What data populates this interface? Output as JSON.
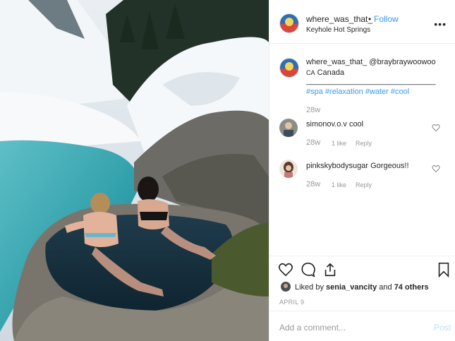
{
  "post": {
    "username": "where_was_that_",
    "follow_label": "Follow",
    "location": "Keyhole Hot Springs",
    "caption": {
      "username": "where_was_that_",
      "mention": "@braybraywoowoo",
      "country_code": "CA",
      "country": "Canada",
      "divider": "______________________________",
      "hashtags": [
        "#spa",
        "#relaxation",
        "#water",
        "#cool"
      ],
      "age": "28w"
    },
    "comments": [
      {
        "username": "simonov.o.v",
        "text": "cool",
        "age": "28w",
        "likes": "1 like",
        "reply": "Reply"
      },
      {
        "username": "pinkskybodysugar",
        "text": "Gorgeous!!",
        "age": "28w",
        "likes": "1 like",
        "reply": "Reply"
      }
    ],
    "likes": {
      "prefix": "Liked by",
      "user": "senia_vancity",
      "and": "and",
      "count_text": "74 others"
    },
    "date": "APRIL 9",
    "add_comment_placeholder": "Add a comment...",
    "post_label": "Post"
  },
  "colors": {
    "link": "#3897f0",
    "text": "#262626",
    "muted": "#999999"
  }
}
